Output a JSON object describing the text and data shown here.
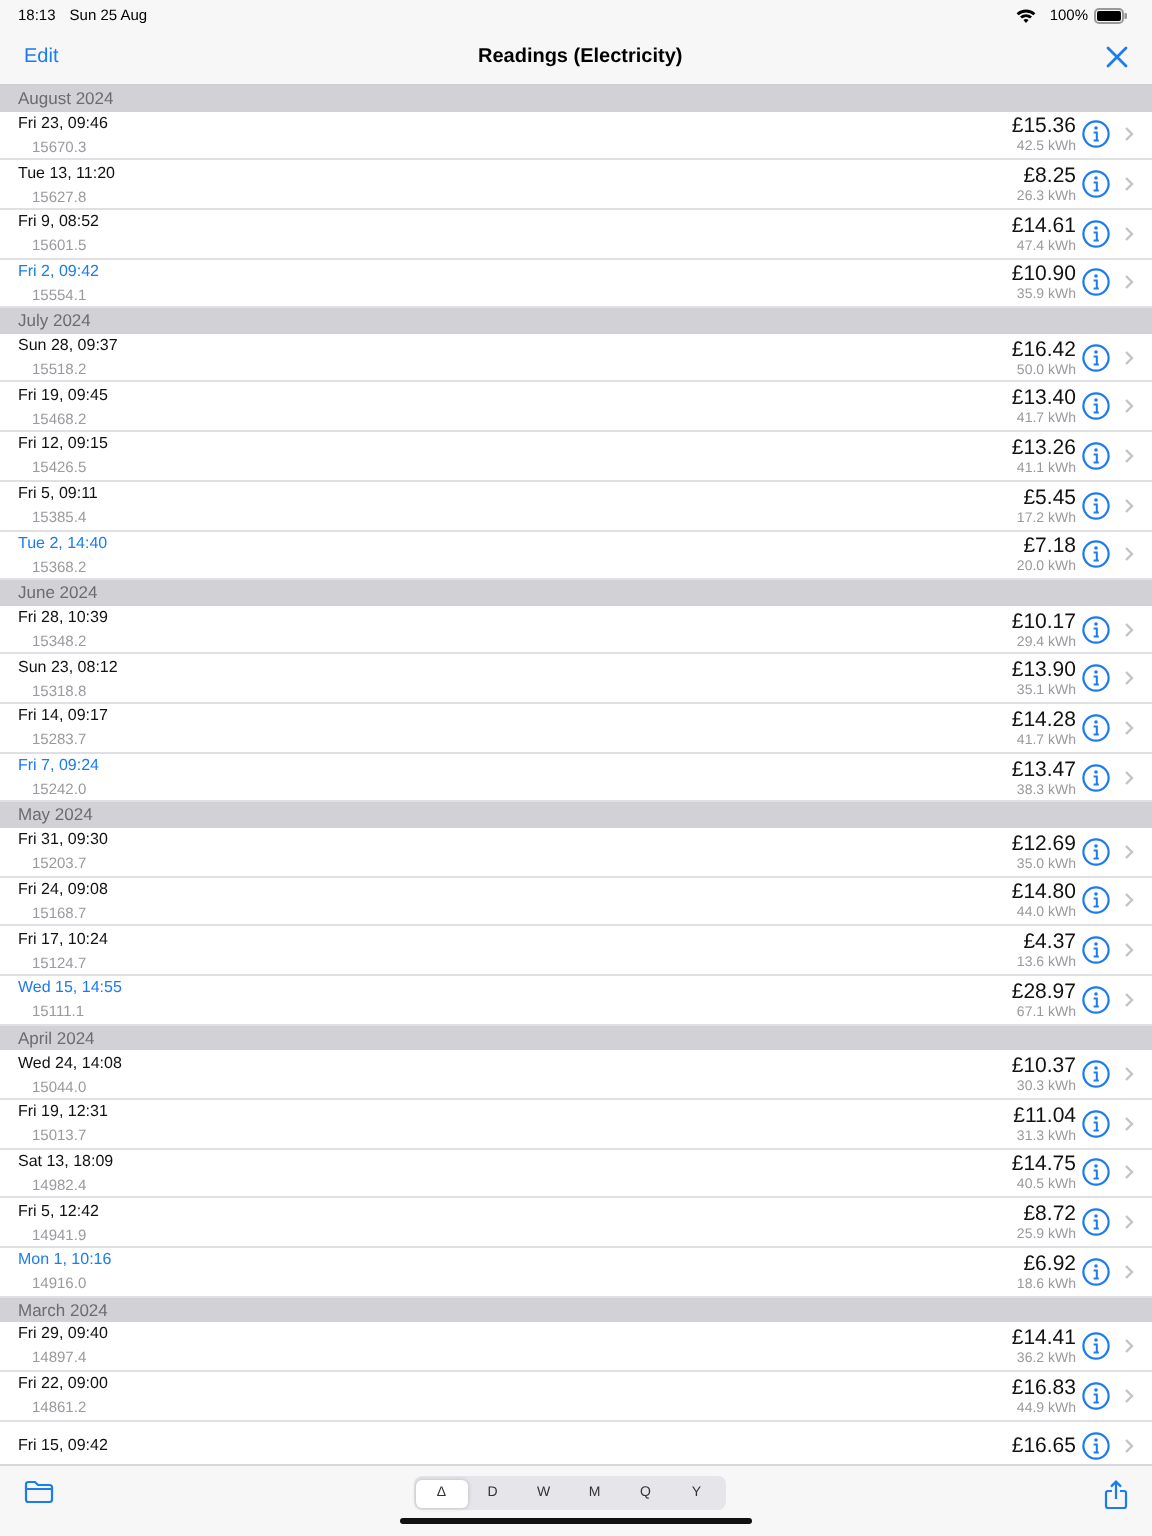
{
  "status_bar": {
    "time": "18:13",
    "date": "Sun 25 Aug",
    "battery": "100%"
  },
  "nav": {
    "left": "Edit",
    "title": "Readings (Electricity)"
  },
  "sections": [
    {
      "title": "August 2024",
      "readings": [
        {
          "date": "Fri 23, 09:46",
          "reading": "15670.3",
          "cost": "£15.36",
          "usage": "42.5 kWh",
          "highlighted": false
        },
        {
          "date": "Tue 13, 11:20",
          "reading": "15627.8",
          "cost": "£8.25",
          "usage": "26.3 kWh",
          "highlighted": false
        },
        {
          "date": "Fri 9, 08:52",
          "reading": "15601.5",
          "cost": "£14.61",
          "usage": "47.4 kWh",
          "highlighted": false
        },
        {
          "date": "Fri 2, 09:42",
          "reading": "15554.1",
          "cost": "£10.90",
          "usage": "35.9 kWh",
          "highlighted": true
        }
      ]
    },
    {
      "title": "July 2024",
      "readings": [
        {
          "date": "Sun 28, 09:37",
          "reading": "15518.2",
          "cost": "£16.42",
          "usage": "50.0 kWh",
          "highlighted": false
        },
        {
          "date": "Fri 19, 09:45",
          "reading": "15468.2",
          "cost": "£13.40",
          "usage": "41.7 kWh",
          "highlighted": false
        },
        {
          "date": "Fri 12, 09:15",
          "reading": "15426.5",
          "cost": "£13.26",
          "usage": "41.1 kWh",
          "highlighted": false
        },
        {
          "date": "Fri 5, 09:11",
          "reading": "15385.4",
          "cost": "£5.45",
          "usage": "17.2 kWh",
          "highlighted": false
        },
        {
          "date": "Tue 2, 14:40",
          "reading": "15368.2",
          "cost": "£7.18",
          "usage": "20.0 kWh",
          "highlighted": true
        }
      ]
    },
    {
      "title": "June 2024",
      "readings": [
        {
          "date": "Fri 28, 10:39",
          "reading": "15348.2",
          "cost": "£10.17",
          "usage": "29.4 kWh",
          "highlighted": false
        },
        {
          "date": "Sun 23, 08:12",
          "reading": "15318.8",
          "cost": "£13.90",
          "usage": "35.1 kWh",
          "highlighted": false
        },
        {
          "date": "Fri 14, 09:17",
          "reading": "15283.7",
          "cost": "£14.28",
          "usage": "41.7 kWh",
          "highlighted": false
        },
        {
          "date": "Fri 7, 09:24",
          "reading": "15242.0",
          "cost": "£13.47",
          "usage": "38.3 kWh",
          "highlighted": true
        }
      ]
    },
    {
      "title": "May 2024",
      "readings": [
        {
          "date": "Fri 31, 09:30",
          "reading": "15203.7",
          "cost": "£12.69",
          "usage": "35.0 kWh",
          "highlighted": false
        },
        {
          "date": "Fri 24, 09:08",
          "reading": "15168.7",
          "cost": "£14.80",
          "usage": "44.0 kWh",
          "highlighted": false
        },
        {
          "date": "Fri 17, 10:24",
          "reading": "15124.7",
          "cost": "£4.37",
          "usage": "13.6 kWh",
          "highlighted": false
        },
        {
          "date": "Wed 15, 14:55",
          "reading": "15111.1",
          "cost": "£28.97",
          "usage": "67.1 kWh",
          "highlighted": true
        }
      ]
    },
    {
      "title": "April 2024",
      "readings": [
        {
          "date": "Wed 24, 14:08",
          "reading": "15044.0",
          "cost": "£10.37",
          "usage": "30.3 kWh",
          "highlighted": false
        },
        {
          "date": "Fri 19, 12:31",
          "reading": "15013.7",
          "cost": "£11.04",
          "usage": "31.3 kWh",
          "highlighted": false
        },
        {
          "date": "Sat 13, 18:09",
          "reading": "14982.4",
          "cost": "£14.75",
          "usage": "40.5 kWh",
          "highlighted": false
        },
        {
          "date": "Fri 5, 12:42",
          "reading": "14941.9",
          "cost": "£8.72",
          "usage": "25.9 kWh",
          "highlighted": false
        },
        {
          "date": "Mon 1, 10:16",
          "reading": "14916.0",
          "cost": "£6.92",
          "usage": "18.6 kWh",
          "highlighted": true
        }
      ]
    },
    {
      "title": "March 2024",
      "readings": [
        {
          "date": "Fri 29, 09:40",
          "reading": "14897.4",
          "cost": "£14.41",
          "usage": "36.2 kWh",
          "highlighted": false
        },
        {
          "date": "Fri 22, 09:00",
          "reading": "14861.2",
          "cost": "£16.83",
          "usage": "44.9 kWh",
          "highlighted": false
        },
        {
          "date": "Fri 15, 09:42",
          "cost": "£16.65",
          "highlighted": false
        }
      ]
    }
  ],
  "periods": [
    {
      "label": "Δ",
      "selected": true
    },
    {
      "label": "D",
      "selected": false
    },
    {
      "label": "W",
      "selected": false
    },
    {
      "label": "M",
      "selected": false
    },
    {
      "label": "Q",
      "selected": false
    },
    {
      "label": "Y",
      "selected": false
    }
  ]
}
